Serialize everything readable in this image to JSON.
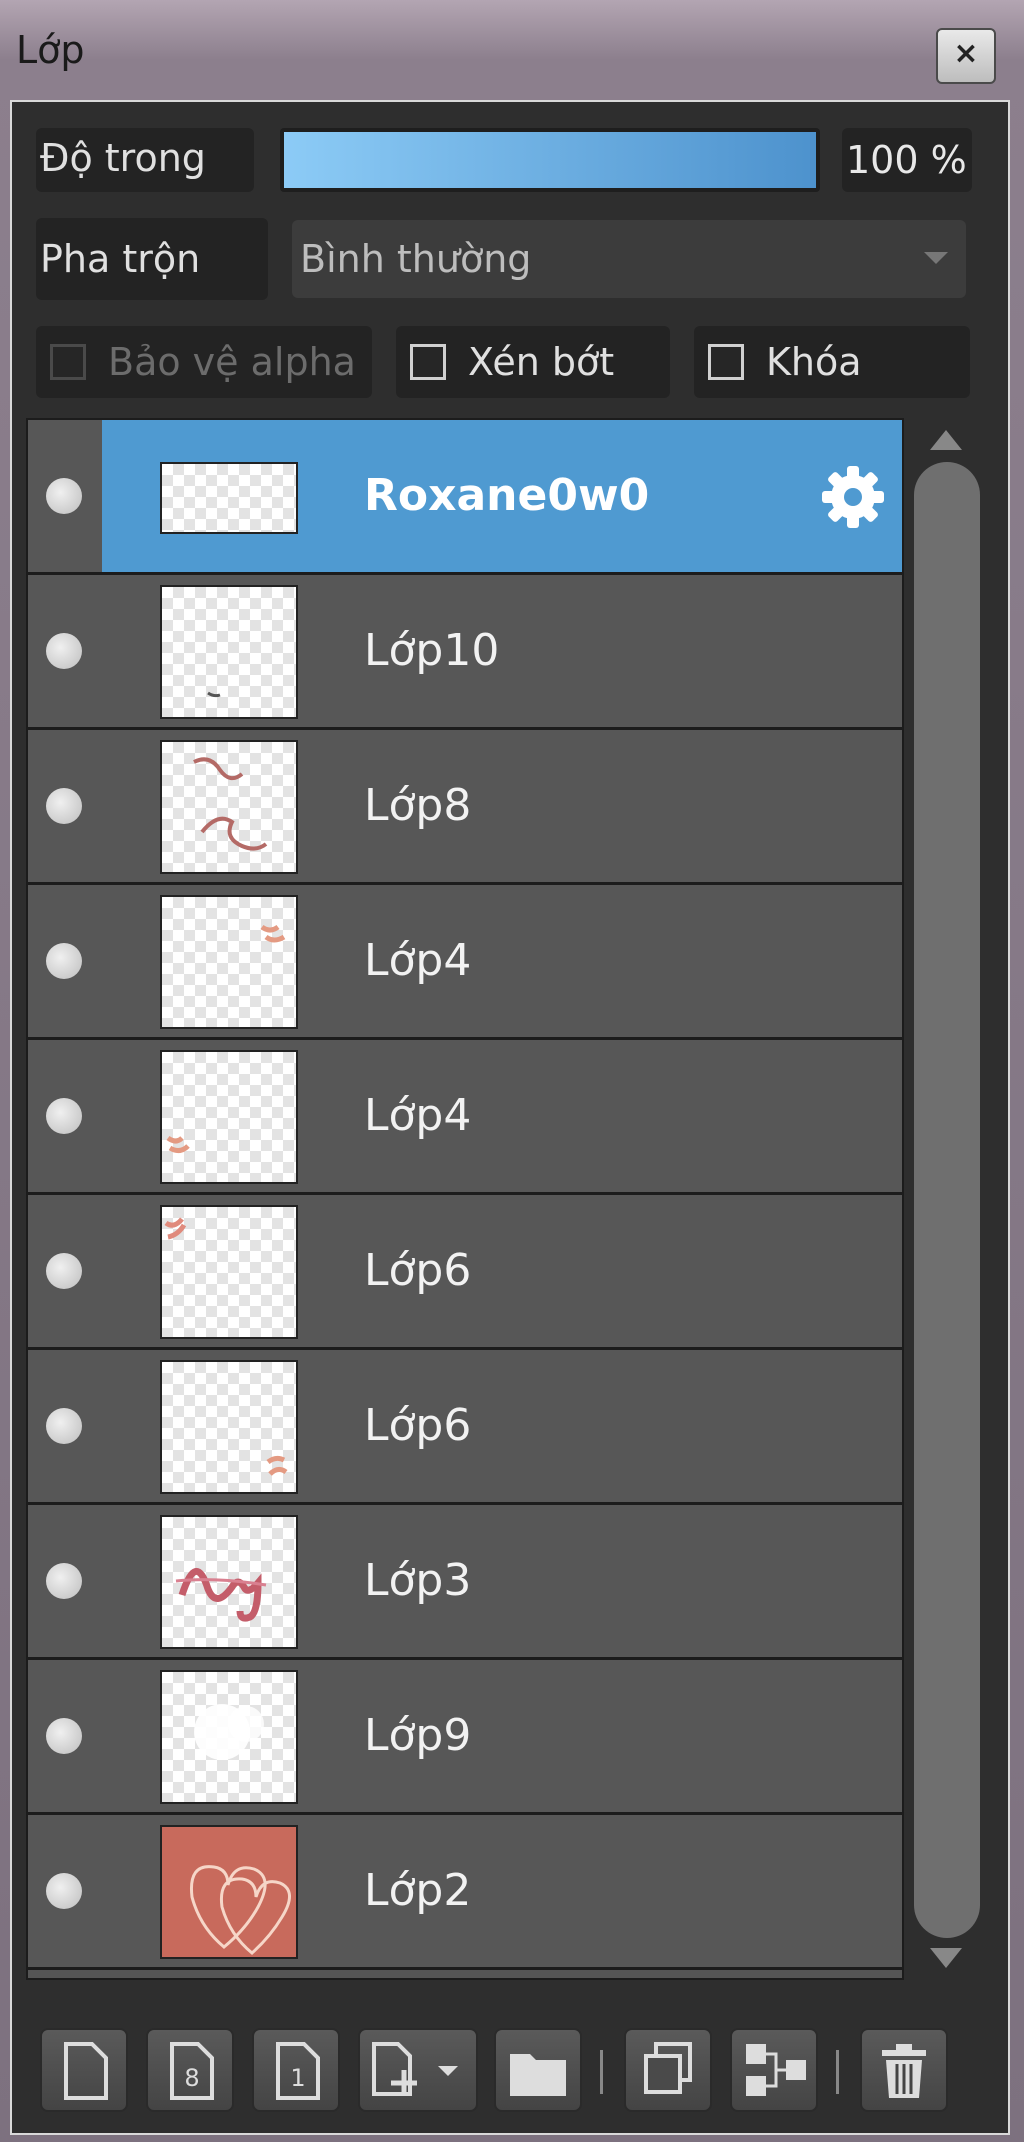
{
  "window": {
    "title": "Lớp",
    "close_label": "×"
  },
  "opacity": {
    "label": "Độ trong",
    "value_text": "100 %",
    "value": 1.0
  },
  "blend": {
    "label": "Pha trộn",
    "selected": "Bình thường"
  },
  "options": {
    "protect_alpha": {
      "label": "Bảo vệ alpha",
      "checked": false,
      "enabled": false
    },
    "clip": {
      "label": "Xén bớt",
      "checked": false,
      "enabled": true
    },
    "lock": {
      "label": "Khóa",
      "checked": false,
      "enabled": true
    }
  },
  "layers": [
    {
      "name": "Roxane0w0",
      "selected": true,
      "visible": true
    },
    {
      "name": "Lớp10",
      "selected": false,
      "visible": true
    },
    {
      "name": "Lớp8",
      "selected": false,
      "visible": true
    },
    {
      "name": "Lớp4",
      "selected": false,
      "visible": true
    },
    {
      "name": "Lớp4",
      "selected": false,
      "visible": true
    },
    {
      "name": "Lớp6",
      "selected": false,
      "visible": true
    },
    {
      "name": "Lớp6",
      "selected": false,
      "visible": true
    },
    {
      "name": "Lớp3",
      "selected": false,
      "visible": true
    },
    {
      "name": "Lớp9",
      "selected": false,
      "visible": true
    },
    {
      "name": "Lớp2",
      "selected": false,
      "visible": true
    }
  ],
  "toolbar": {
    "icons": [
      "new-layer-icon",
      "new-8bit-layer-icon",
      "new-1bit-layer-icon",
      "add-layer-dropdown-icon",
      "folder-icon",
      "duplicate-icon",
      "merge-down-icon",
      "delete-icon"
    ],
    "badge_8": "8",
    "badge_1": "1"
  },
  "colors": {
    "selection": "#4f9ad1",
    "opacity_fill_start": "#8ccbf6",
    "opacity_fill_end": "#4d92cd"
  }
}
